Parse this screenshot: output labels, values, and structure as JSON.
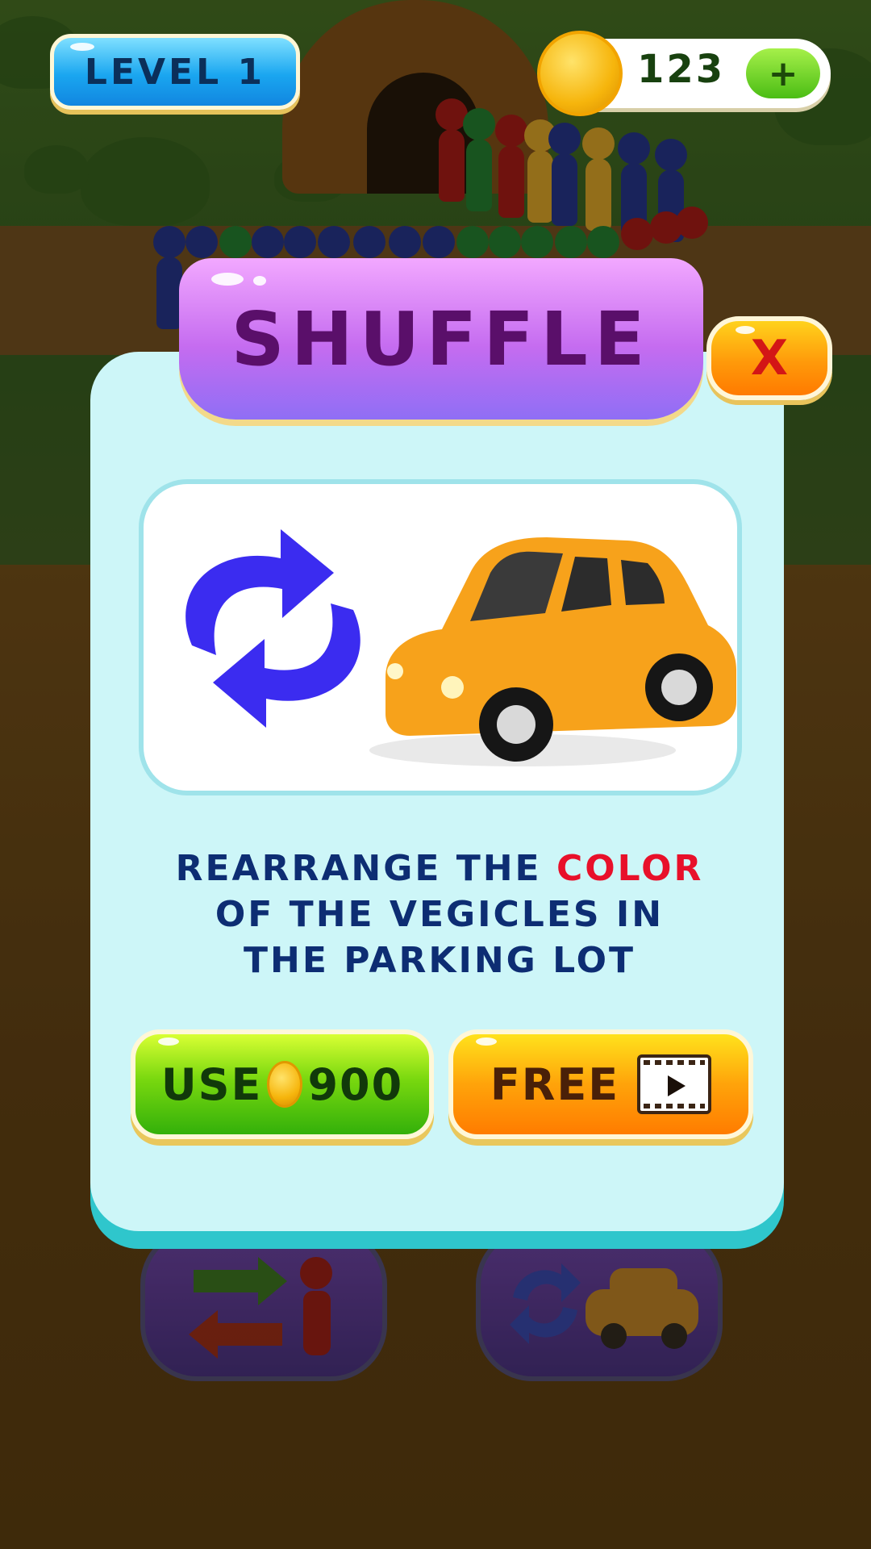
{
  "hud": {
    "level_label": "LEVEL 1",
    "coin_count": "123",
    "add_coins_label": "+"
  },
  "dialog": {
    "title": "SHUFFLE",
    "close_label": "X",
    "description": {
      "line1_before": "REARRANGE THE ",
      "line1_highlight": "COLOR",
      "line2": "OF THE VEGICLES IN",
      "line3": "THE PARKING LOT"
    },
    "use_button": {
      "label_use": "USE",
      "cost": "900"
    },
    "free_button": {
      "label": "FREE"
    }
  },
  "colors": {
    "accent_title": "#5a0f6a",
    "highlight": "#e8102a",
    "text": "#0d2d73",
    "panel": "#cdf6f8"
  },
  "icons": {
    "shuffle": "shuffle-arrows-icon",
    "car": "car-icon",
    "coin": "coin-icon",
    "video": "video-ad-icon",
    "swap_person": "swap-person-icon"
  }
}
